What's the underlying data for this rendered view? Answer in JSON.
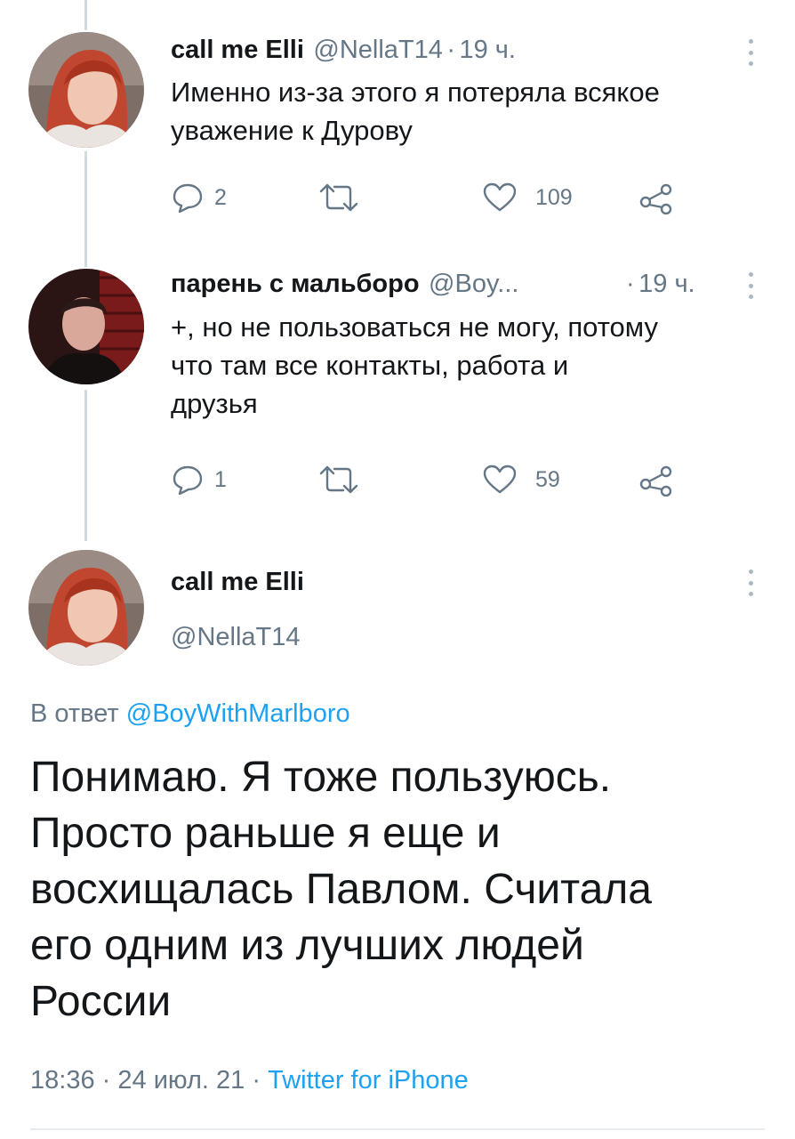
{
  "tweets": [
    {
      "display_name": "call me Elli",
      "handle": "@NellaT14",
      "separator": "·",
      "time": "19 ч.",
      "text_lines": [
        "Именно из-за этого я потеряла всякое",
        "уважение к Дурову"
      ],
      "replies": "2",
      "likes": "109"
    },
    {
      "display_name": "парень с мальборо",
      "handle": "@Boy...",
      "separator": "·",
      "time": "19 ч.",
      "text_lines": [
        "+, но не пользоваться не могу, потому",
        "что там все контакты, работа и",
        "друзья"
      ],
      "replies": "1",
      "likes": "59"
    }
  ],
  "main_tweet": {
    "display_name": "call me Elli",
    "handle": "@NellaT14",
    "reply_prefix": "В ответ",
    "reply_to": "@BoyWithMarlboro",
    "text_lines": [
      "Понимаю. Я тоже пользуюсь.",
      "Просто раньше я еще и",
      "восхищалась Павлом. Считала",
      "его одним из лучших людей",
      "России"
    ],
    "time": "18:36",
    "separator": "·",
    "date": "24 июл. 21",
    "source": "Twitter for iPhone"
  },
  "colors": {
    "accent": "#1da1f2",
    "text": "#14171a",
    "muted": "#657786",
    "thread_line": "#cfd9de"
  },
  "icons": [
    "reply-icon",
    "retweet-icon",
    "like-icon",
    "share-icon",
    "more-icon"
  ]
}
